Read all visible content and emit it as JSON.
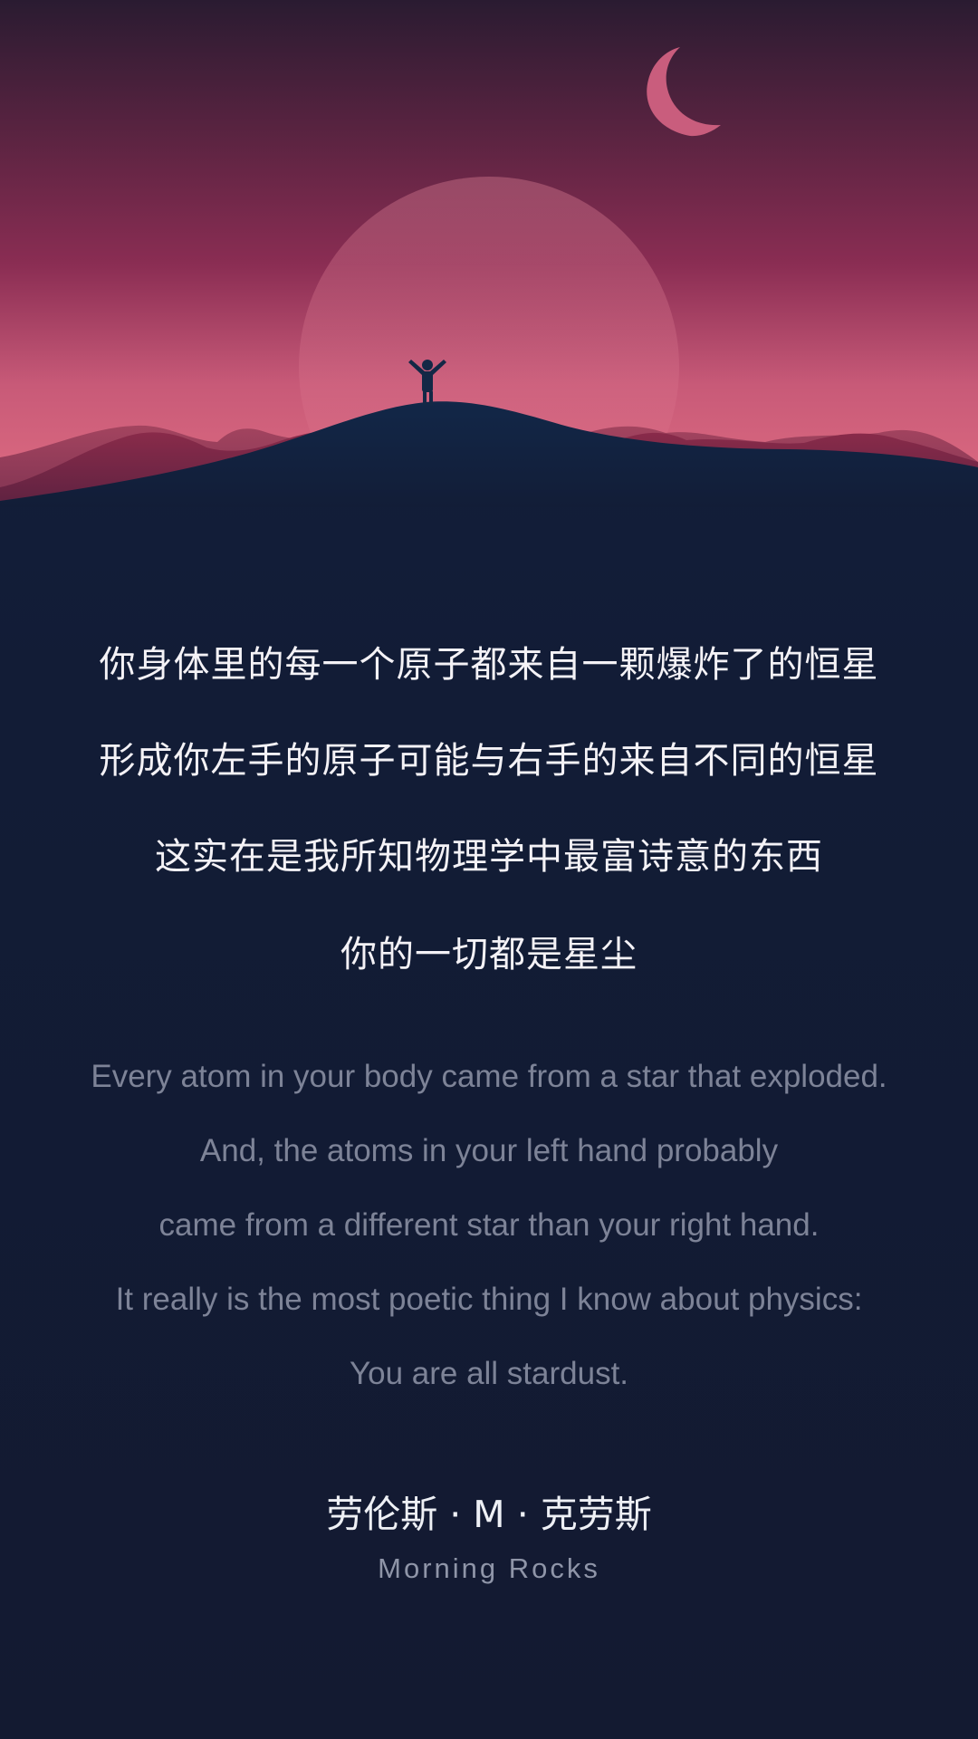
{
  "scene": {
    "sky_top_color": "#2c1d32",
    "sky_mid_color": "#7b2a4c",
    "sky_bottom_color": "#d35c76",
    "hill_color": "#10223f",
    "moon_color": "#c65c7a"
  },
  "poem": {
    "chinese_lines": [
      "你身体里的每一个原子都来自一颗爆炸了的恒星",
      "形成你左手的原子可能与右手的来自不同的恒星",
      "这实在是我所知物理学中最富诗意的东西",
      "你的一切都是星尘"
    ],
    "english_lines": [
      "Every atom in your body came from a star that exploded.",
      "And, the atoms in your left hand probably",
      "came from a different star than your right hand.",
      "It really is the most poetic thing I know about physics:",
      "You are all stardust."
    ]
  },
  "footer": {
    "author": "劳伦斯 · M · 克劳斯",
    "brand": "Morning Rocks"
  }
}
